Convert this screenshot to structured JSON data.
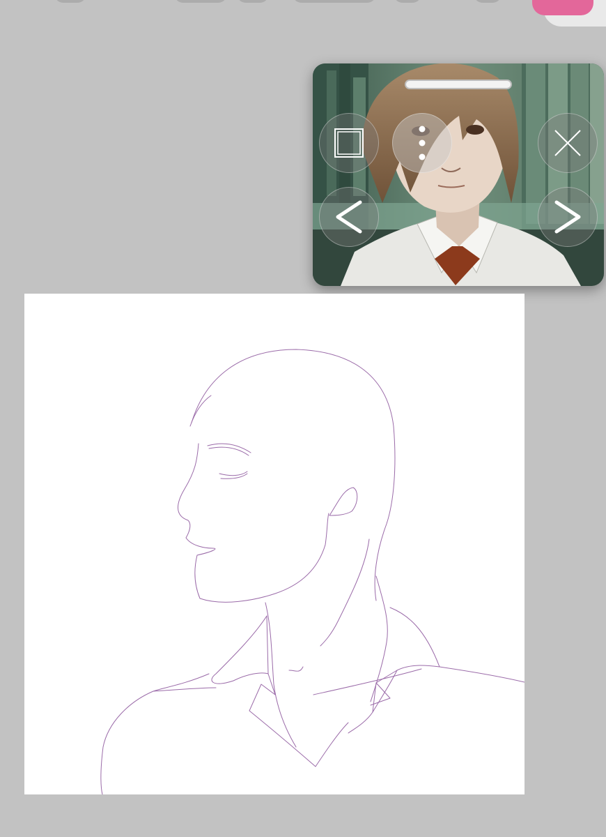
{
  "app": {
    "background_color": "#c2c2c2",
    "accent_color": "#e3679a"
  },
  "toolbar": {
    "icons": [
      "tool-icon",
      "tool-icon",
      "tool-icon",
      "tool-icon",
      "tool-icon"
    ],
    "color_swatch": "#e3679a"
  },
  "reference_window": {
    "controls": {
      "window": "square-icon",
      "menu": "more-vertical-icon",
      "close": "close-icon",
      "previous": "chevron-left-icon",
      "next": "chevron-right-icon"
    }
  },
  "canvas": {
    "background": "#ffffff",
    "line_color": "#9a6aa8"
  }
}
